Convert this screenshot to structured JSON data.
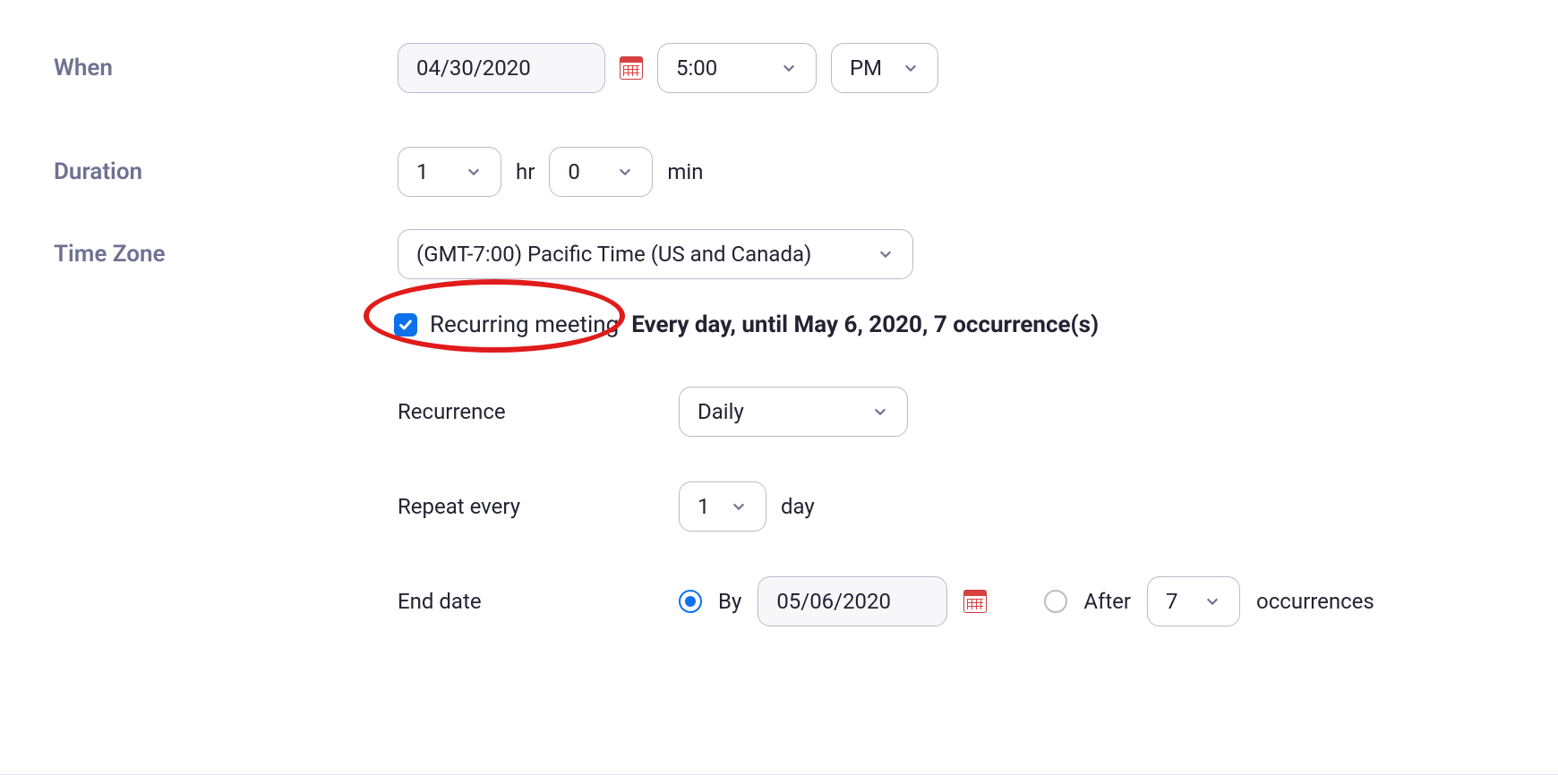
{
  "labels": {
    "when": "When",
    "duration": "Duration",
    "timezone": "Time Zone",
    "recurrence": "Recurrence",
    "repeat_every": "Repeat every",
    "end_date": "End date"
  },
  "when": {
    "date": "04/30/2020",
    "time": "5:00",
    "ampm": "PM"
  },
  "duration": {
    "hours": "1",
    "hours_unit": "hr",
    "minutes": "0",
    "minutes_unit": "min"
  },
  "timezone": {
    "value": "(GMT-7:00) Pacific Time (US and Canada)"
  },
  "recurring": {
    "checkbox_label": "Recurring meeting",
    "summary": "Every day, until May 6, 2020, 7 occurrence(s)",
    "recurrence_value": "Daily",
    "repeat_value": "1",
    "repeat_unit": "day"
  },
  "end": {
    "by_label": "By",
    "by_date": "05/06/2020",
    "after_label": "After",
    "after_count": "7",
    "after_unit": "occurrences"
  }
}
